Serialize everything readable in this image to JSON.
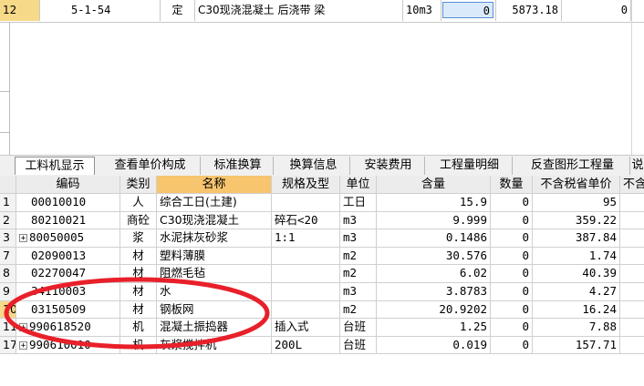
{
  "top_row": {
    "row_num": "12",
    "code": "5-1-54",
    "type": "定",
    "name": "C30现浇混凝土 后浇带 梁",
    "unit": "10m3",
    "qty": "0",
    "price": "5873.18",
    "total": "0"
  },
  "tabs": [
    "工料机显示",
    "查看单价构成",
    "标准换算",
    "换算信息",
    "安装费用",
    "工程量明细",
    "反查图形工程量",
    "说"
  ],
  "table": {
    "headers": [
      "编码",
      "类别",
      "名称",
      "规格及型",
      "单位",
      "含量",
      "数量",
      "不含税省单价",
      "不含"
    ],
    "rows": [
      {
        "num": "1",
        "code": "00010010",
        "cat": "人",
        "name": "综合工日(土建)",
        "spec": "",
        "unit": "工日",
        "content": "15.9",
        "qty": "0",
        "price": "95",
        "expand": false
      },
      {
        "num": "2",
        "code": "80210021",
        "cat": "商砼",
        "name": "C30现浇混凝土",
        "spec": "碎石<20",
        "unit": "m3",
        "content": "9.999",
        "qty": "0",
        "price": "359.22",
        "expand": false
      },
      {
        "num": "3",
        "code": "80050005",
        "cat": "浆",
        "name": "水泥抹灰砂浆",
        "spec": "1:1",
        "unit": "m3",
        "content": "0.1486",
        "qty": "0",
        "price": "387.84",
        "expand": true
      },
      {
        "num": "7",
        "code": "02090013",
        "cat": "材",
        "name": "塑料薄膜",
        "spec": "",
        "unit": "m2",
        "content": "30.576",
        "qty": "0",
        "price": "1.74",
        "expand": false
      },
      {
        "num": "8",
        "code": "02270047",
        "cat": "材",
        "name": "阻燃毛毡",
        "spec": "",
        "unit": "m2",
        "content": "6.02",
        "qty": "0",
        "price": "40.39",
        "expand": false
      },
      {
        "num": "9",
        "code": "34110003",
        "cat": "材",
        "name": "水",
        "spec": "",
        "unit": "m3",
        "content": "3.8783",
        "qty": "0",
        "price": "4.27",
        "expand": false
      },
      {
        "num": "10",
        "code": "03150509",
        "cat": "材",
        "name": "钢板网",
        "spec": "",
        "unit": "m2",
        "content": "20.9202",
        "qty": "0",
        "price": "16.24",
        "expand": false
      },
      {
        "num": "11",
        "code": "990618520",
        "cat": "机",
        "name": "混凝土振捣器",
        "spec": "插入式",
        "unit": "台班",
        "content": "1.25",
        "qty": "0",
        "price": "7.88",
        "expand": true
      },
      {
        "num": "17",
        "code": "990610010",
        "cat": "机",
        "name": "灰浆搅拌机",
        "spec": "200L",
        "unit": "台班",
        "content": "0.019",
        "qty": "0",
        "price": "157.71",
        "expand": true
      }
    ]
  },
  "colors": {
    "annotation_circle": "#e8202a",
    "selected_row": "#f7d98a",
    "name_header": "#f7c56e"
  }
}
